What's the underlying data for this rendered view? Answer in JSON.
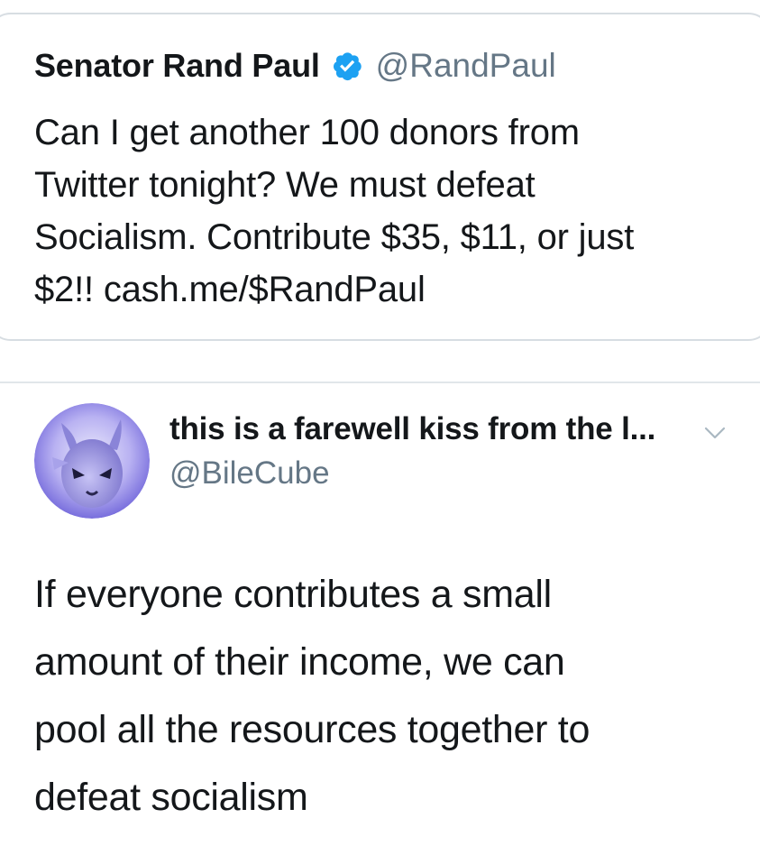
{
  "quoted_tweet": {
    "author_name": "Senator Rand Paul",
    "handle": "@RandPaul",
    "verified_icon": "verified-badge-icon",
    "text_lines": [
      "Can I get another 100 donors from",
      "Twitter tonight? We must defeat",
      "Socialism. Contribute $35, $11, or just",
      "$2!! cash.me/$RandPaul"
    ]
  },
  "reply_tweet": {
    "author_name": "this is a farewell kiss from the l...",
    "handle": "@BileCube",
    "menu_icon": "chevron-down-icon",
    "text_lines": [
      "If everyone contributes a small",
      "amount of their income, we can",
      "pool all the resources together to",
      "defeat socialism"
    ]
  },
  "colors": {
    "text_primary": "#14171a",
    "text_secondary": "#657786",
    "verified_blue": "#1da1f2",
    "border": "#d7dde2"
  }
}
